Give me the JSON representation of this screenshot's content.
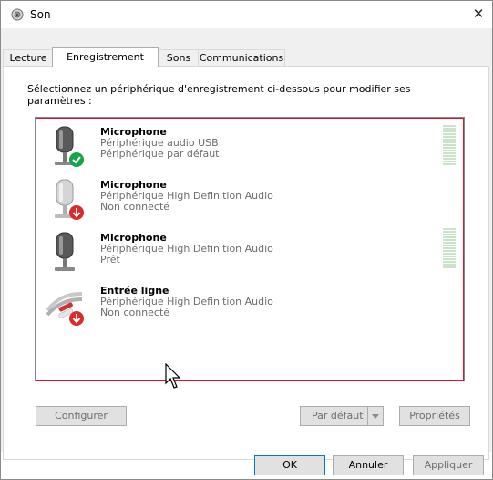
{
  "window": {
    "title": "Son",
    "close_glyph": "✕"
  },
  "tabs": [
    {
      "label": "Lecture",
      "active": false
    },
    {
      "label": "Enregistrement",
      "active": true
    },
    {
      "label": "Sons",
      "active": false
    },
    {
      "label": "Communications",
      "active": false
    }
  ],
  "instruction": "Sélectionnez un périphérique d'enregistrement ci-dessous pour modifier ses paramètres :",
  "devices": [
    {
      "name": "Microphone",
      "line1": "Périphérique audio USB",
      "line2": "Périphérique par défaut",
      "icon": "microphone-icon",
      "status_icon": "default-check-icon",
      "status_color": "#16a34a",
      "has_level_meter": true
    },
    {
      "name": "Microphone",
      "line1": "Périphérique High Definition Audio",
      "line2": "Non connecté",
      "icon": "microphone-icon",
      "status_icon": "disconnected-arrow-icon",
      "status_color": "#d92b2b",
      "has_level_meter": false
    },
    {
      "name": "Microphone",
      "line1": "Périphérique High Definition Audio",
      "line2": "Prêt",
      "icon": "microphone-icon",
      "status_icon": "",
      "status_color": "",
      "has_level_meter": true
    },
    {
      "name": "Entrée ligne",
      "line1": "Périphérique High Definition Audio",
      "line2": "Non connecté",
      "icon": "line-in-cable-icon",
      "status_icon": "disconnected-arrow-icon",
      "status_color": "#d92b2b",
      "has_level_meter": false
    }
  ],
  "buttons": {
    "configure": "Configurer",
    "set_default": "Par défaut",
    "properties": "Propriétés",
    "ok": "OK",
    "cancel": "Annuler",
    "apply": "Appliquer"
  },
  "colors": {
    "selection_border": "#e81123",
    "default_button_border": "#0078d7",
    "meter_green": "#c9e4c9"
  }
}
